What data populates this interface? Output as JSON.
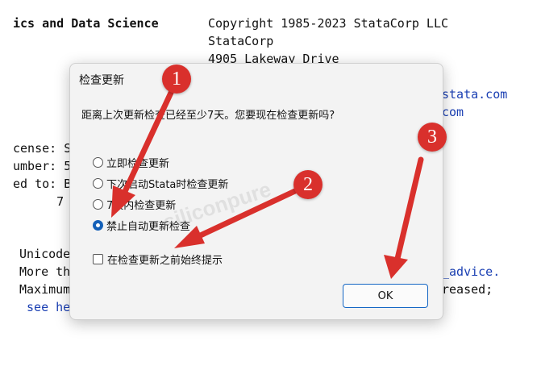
{
  "background": {
    "left_lines": [
      "ics and Data Science",
      "cense: S",
      "umber: 5",
      "ed to: B",
      "      7"
    ],
    "right_lines": [
      "Copyright 1985-2023 StataCorp LLC",
      "StataCorp",
      "4905 Lakeway Drive"
    ],
    "right_links": [
      "stata.com",
      "com"
    ],
    "lower_left": [
      "Unicode",
      "More th",
      "Maximum",
      " see he"
    ],
    "lower_right": [
      "_advice.",
      "reased;"
    ]
  },
  "dialog": {
    "title": "检查更新",
    "question": "距离上次更新检查已经至少7天。您要现在检查更新吗?",
    "options": [
      {
        "label": "立即检查更新",
        "selected": false
      },
      {
        "label": "下次启动Stata时检查更新",
        "selected": false
      },
      {
        "label": "7天内检查更新",
        "selected": false
      },
      {
        "label": "禁止自动更新检查",
        "selected": true
      }
    ],
    "checkbox_label": "在检查更新之前始终提示",
    "checkbox_checked": false,
    "ok_label": "OK"
  },
  "annotations": {
    "badges": [
      "1",
      "2",
      "3"
    ],
    "color": "#d9302c"
  },
  "watermark": "siliconpure"
}
